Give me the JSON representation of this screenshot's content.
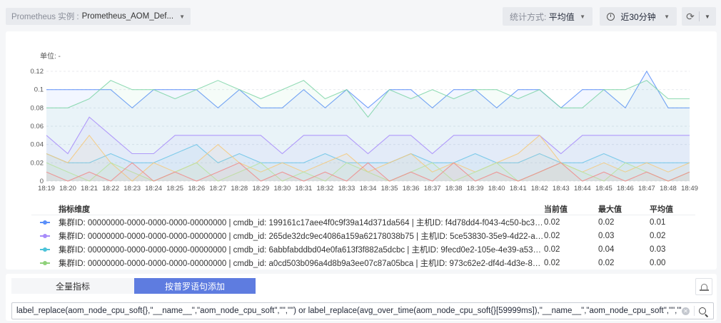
{
  "instance": {
    "prefix": "Prometheus 实例 :",
    "value": "Prometheus_AOM_Def..."
  },
  "stat_mode": {
    "prefix": "统计方式:",
    "value": "平均值"
  },
  "time_range": {
    "value": "近30分钟"
  },
  "icons": {
    "refresh": "refresh-icon",
    "clock": "clock-icon",
    "bell": "bell-icon",
    "search": "search-icon",
    "clear": "clear-icon"
  },
  "chart_data": {
    "type": "area",
    "unit_label": "单位: -",
    "x": [
      "18:19",
      "18:20",
      "18:21",
      "18:22",
      "18:23",
      "18:24",
      "18:25",
      "18:26",
      "18:27",
      "18:28",
      "18:29",
      "18:30",
      "18:31",
      "18:32",
      "18:33",
      "18:34",
      "18:35",
      "18:36",
      "18:37",
      "18:38",
      "18:39",
      "18:40",
      "18:41",
      "18:42",
      "18:43",
      "18:44",
      "18:45",
      "18:46",
      "18:47",
      "18:48",
      "18:49"
    ],
    "yticks": [
      0,
      0.02,
      0.04,
      0.06,
      0.08,
      0.1,
      0.12
    ],
    "ylim": [
      0,
      0.12
    ],
    "grid": true,
    "series": [
      {
        "color": "#5b8ff9",
        "values": [
          0.1,
          0.1,
          0.1,
          0.1,
          0.08,
          0.1,
          0.1,
          0.1,
          0.08,
          0.1,
          0.08,
          0.08,
          0.1,
          0.08,
          0.1,
          0.08,
          0.1,
          0.1,
          0.08,
          0.1,
          0.1,
          0.08,
          0.1,
          0.1,
          0.08,
          0.1,
          0.1,
          0.08,
          0.12,
          0.08,
          0.08
        ]
      },
      {
        "color": "#7fd5a8",
        "values": [
          0.08,
          0.08,
          0.09,
          0.11,
          0.1,
          0.1,
          0.09,
          0.1,
          0.11,
          0.1,
          0.09,
          0.1,
          0.11,
          0.09,
          0.1,
          0.07,
          0.1,
          0.09,
          0.1,
          0.09,
          0.1,
          0.1,
          0.09,
          0.1,
          0.08,
          0.08,
          0.1,
          0.1,
          0.11,
          0.09,
          0.09
        ]
      },
      {
        "color": "#a78bfa",
        "values": [
          0.05,
          0.03,
          0.07,
          0.05,
          0.03,
          0.03,
          0.05,
          0.05,
          0.05,
          0.05,
          0.05,
          0.03,
          0.05,
          0.05,
          0.05,
          0.03,
          0.05,
          0.05,
          0.03,
          0.05,
          0.05,
          0.05,
          0.05,
          0.05,
          0.03,
          0.05,
          0.05,
          0.05,
          0.05,
          0.05,
          0.05
        ]
      },
      {
        "color": "#6fc6e8",
        "values": [
          0.03,
          0.02,
          0.02,
          0.03,
          0.02,
          0.02,
          0.03,
          0.04,
          0.02,
          0.03,
          0.02,
          0.02,
          0.02,
          0.03,
          0.02,
          0.02,
          0.02,
          0.03,
          0.02,
          0.02,
          0.03,
          0.02,
          0.02,
          0.03,
          0.02,
          0.02,
          0.03,
          0.02,
          0.02,
          0.02,
          0.02
        ]
      },
      {
        "color": "#f6c97a",
        "values": [
          0.03,
          0.02,
          0.05,
          0.02,
          0,
          0.02,
          0.01,
          0.02,
          0.04,
          0.02,
          0.01,
          0.02,
          0.01,
          0.02,
          0.03,
          0.01,
          0.02,
          0.03,
          0.01,
          0.02,
          0.01,
          0.02,
          0.03,
          0.05,
          0.02,
          0.01,
          0.02,
          0.01,
          0.02,
          0.01,
          0.02
        ]
      },
      {
        "color": "#b7e4a0",
        "values": [
          0.02,
          0.01,
          0,
          0.02,
          0.01,
          0,
          0.01,
          0.02,
          0,
          0.01,
          0.02,
          0,
          0.01,
          0,
          0.02,
          0.01,
          0,
          0.01,
          0.02,
          0,
          0.01,
          0.02,
          0,
          0.01,
          0.02,
          0.01,
          0,
          0.02,
          0.01,
          0,
          0.01
        ]
      },
      {
        "color": "#f08a8a",
        "values": [
          0.01,
          0,
          0.01,
          0,
          0.02,
          0,
          0.01,
          0,
          0.01,
          0.02,
          0,
          0.01,
          0,
          0.01,
          0,
          0.02,
          0,
          0.01,
          0,
          0.02,
          0,
          0.01,
          0,
          0.01,
          0.02,
          0,
          0.01,
          0,
          0.01,
          0,
          0.01
        ]
      }
    ]
  },
  "legend": {
    "headers": {
      "dimension": "指标维度",
      "current": "当前值",
      "max": "最大值",
      "avg": "平均值"
    },
    "rows": [
      {
        "color": "#5b8ff9",
        "dimension": "集群ID: 00000000-0000-0000-0000-00000000 | cmdb_id: 199161c17aee4f0c9f39a14d371da564 | 主机ID: f4d78dd4-f043-4c50-bc3d-3c6aa...",
        "current": "0.02",
        "max": "0.02",
        "avg": "0.01"
      },
      {
        "color": "#a78bfa",
        "dimension": "集群ID: 00000000-0000-0000-0000-00000000 | cmdb_id: 265de32dc9ec4086a159a62178038b75 | 主机ID: 5ce53830-35e9-4d22-a63d-e9...",
        "current": "0.02",
        "max": "0.03",
        "avg": "0.02"
      },
      {
        "color": "#4cc3d9",
        "dimension": "集群ID: 00000000-0000-0000-0000-00000000 | cmdb_id: 6abbfabddbd04e0fa613f3f882a5dcbc | 主机ID: 9fecd0e2-105e-4e39-a536-743aff...",
        "current": "0.02",
        "max": "0.04",
        "avg": "0.03"
      },
      {
        "color": "#8fd17a",
        "dimension": "集群ID: 00000000-0000-0000-0000-00000000 | cmdb_id: a0cd503b096a4d8b9a3ee07c87a05bca | 主机ID: 973c62e2-df4d-4d3e-86d0-8fe1...",
        "current": "0.02",
        "max": "0.02",
        "avg": "0.00"
      }
    ]
  },
  "tabs": {
    "all_metrics": "全量指标",
    "add_by_promql": "按普罗语句添加"
  },
  "query": {
    "value": "label_replace(aom_node_cpu_soft{},\"__name__\",\"aom_node_cpu_soft\",\"\",\"\") or label_replace(avg_over_time(aom_node_cpu_soft{}[59999ms]),\"__name__\",\"aom_node_cpu_soft\",\"\",\"\")"
  }
}
